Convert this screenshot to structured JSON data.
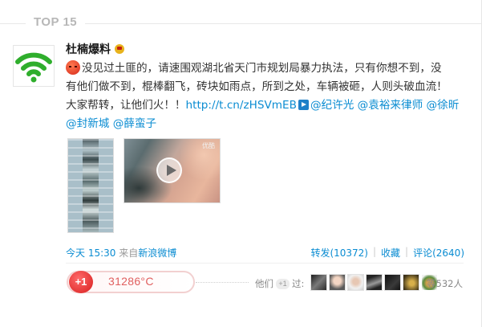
{
  "header": {
    "rank_label": "TOP 15"
  },
  "post": {
    "username": "杜楠爆料",
    "text_line1": "没见过土匪的，请速围观湖北省天门市规划局暴力执法，只有你想不到，没",
    "text_line2": "有他们做不到，棍棒翻飞，砖块如雨点，所到之处，车辆被砸，人则头破血流！",
    "text_line3_prefix": "大家帮转，让他们火！！",
    "short_link": "http://t.cn/zHSVmEB",
    "mentions_line3": "@纪许光 @袁裕来律师 @徐昕",
    "mentions_line4": "@封新城 @薛蛮子",
    "video_tag": "优酷"
  },
  "meta": {
    "time": "今天 15:30",
    "source_prefix": "来自",
    "source": "新浪微博",
    "repost": "转发(10372)",
    "favorite": "收藏",
    "comment": "评论(2640)",
    "separator": "|"
  },
  "heat": {
    "plus_one": "+1",
    "temperature": "31286°C",
    "they_label": "他们",
    "mini_badge": "+1",
    "passed_label": "过:",
    "others_count": "等532人"
  },
  "icons": {
    "avatar": "wifi-icon",
    "vip": "crown-icon",
    "emoji": "angry-face-icon",
    "video_link": "video-play-icon",
    "play": "play-icon"
  },
  "colors": {
    "link": "#0a8cd2",
    "temperature": "#e06060",
    "plus_one": "#d81e1e",
    "rank_label": "#b7b7b7"
  }
}
